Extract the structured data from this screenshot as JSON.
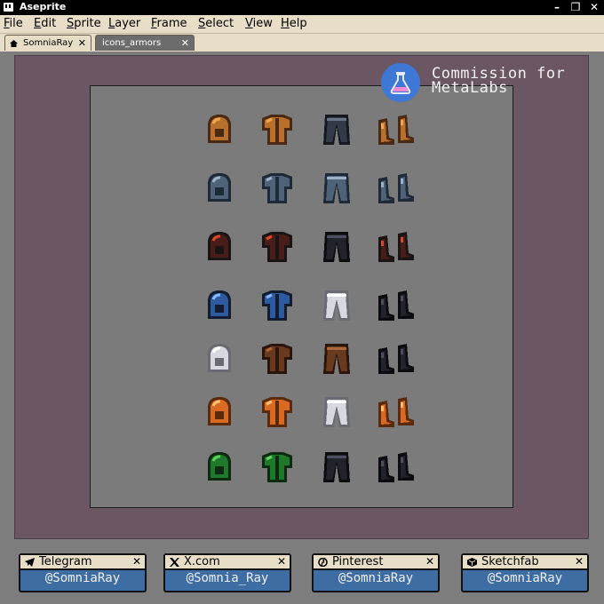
{
  "window": {
    "title": "Aseprite"
  },
  "menu": [
    "File",
    "Edit",
    "Sprite",
    "Layer",
    "Frame",
    "Select",
    "View",
    "Help"
  ],
  "tabs": [
    {
      "label": "SomniaRay",
      "icon": "home-icon"
    },
    {
      "label": "icons_armors",
      "active": true
    }
  ],
  "badge": {
    "line1": "Commission for",
    "line2": "MetaLabs",
    "icon": "flask-icon",
    "color": "#3f78d4"
  },
  "sprites": [
    [
      "helmet-bronze",
      "chest-bronze",
      "pants-dark",
      "boots-bronze"
    ],
    [
      "helmet-steel",
      "chest-steel",
      "pants-steel",
      "boots-steel"
    ],
    [
      "hood-black-red",
      "robe-red",
      "pants-black",
      "boots-red"
    ],
    [
      "hat-blue",
      "coat-blue",
      "pants-white",
      "boots-black"
    ],
    [
      "hood-white",
      "jacket-brown",
      "pants-brown",
      "boots-black"
    ],
    [
      "helmet-orange",
      "chest-orange",
      "pants-white-orange",
      "boots-orange"
    ],
    [
      "hood-green",
      "chest-green",
      "pants-black",
      "boots-black"
    ]
  ],
  "socials": [
    {
      "name": "Telegram",
      "handle": "@SomniaRay",
      "icon": "telegram-icon"
    },
    {
      "name": "X.com",
      "handle": "@Somnia_Ray",
      "icon": "x-icon"
    },
    {
      "name": "Pinterest",
      "handle": "@SomniaRay",
      "icon": "pinterest-icon"
    },
    {
      "name": "Sketchfab",
      "handle": "@SomniaRay",
      "icon": "sketchfab-icon"
    }
  ]
}
